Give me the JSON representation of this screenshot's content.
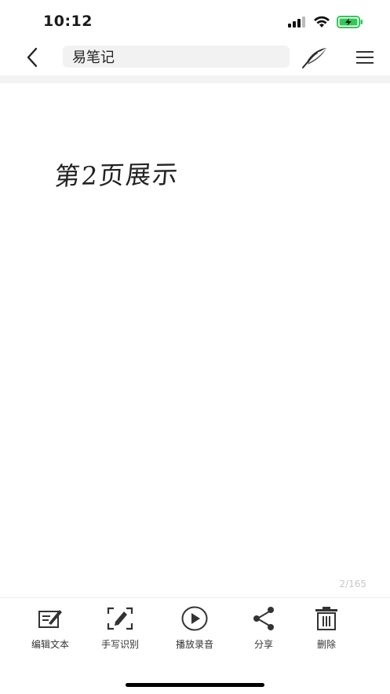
{
  "status_bar": {
    "time": "10:12"
  },
  "nav": {
    "title": "易笔记"
  },
  "canvas": {
    "handwriting_text": "第2页展示",
    "page_counter": "2/165"
  },
  "toolbar": {
    "edit_text": "编辑文本",
    "handwriting_recognition": "手写识别",
    "play_recording": "播放录音",
    "share": "分享",
    "delete": "删除"
  },
  "colors": {
    "accent": "#2e2e2e",
    "battery": "#34c759",
    "muted": "#c8c8c8"
  }
}
